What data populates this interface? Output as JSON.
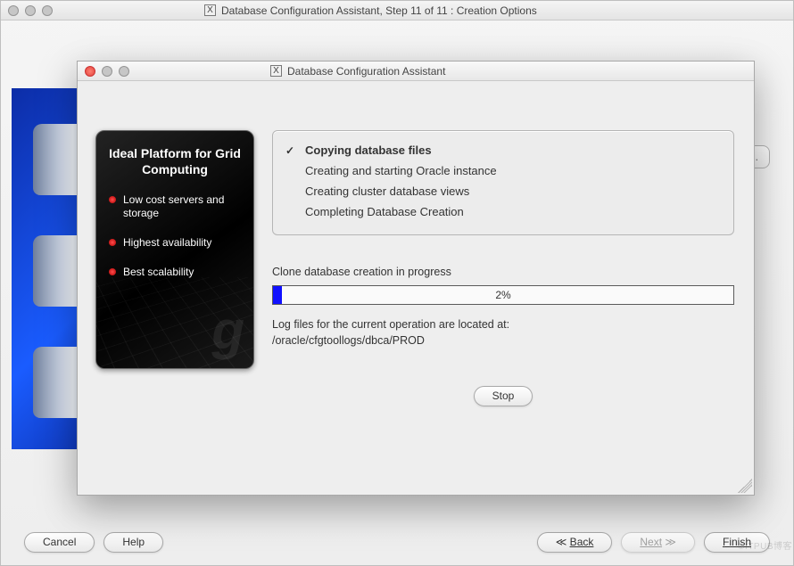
{
  "back_window": {
    "title": "Database Configuration Assistant, Step 11 of 11 : Creation Options",
    "truncated_text": "",
    "hidden_button_fragment": "wse...",
    "buttons": {
      "cancel": "Cancel",
      "help": "Help",
      "back": "Back",
      "next": "Next",
      "finish": "Finish"
    }
  },
  "front_window": {
    "title": "Database Configuration Assistant"
  },
  "banner": {
    "heading": "Ideal Platform for Grid Computing",
    "items": [
      "Low cost servers and storage",
      "Highest availability",
      "Best scalability"
    ]
  },
  "steps": {
    "list": [
      "Copying database files",
      "Creating and starting Oracle instance",
      "Creating cluster database views",
      "Completing Database Creation"
    ],
    "current_index": 0
  },
  "progress": {
    "label": "Clone database creation in progress",
    "percent": 2,
    "percent_text": "2%",
    "log_text_line1": "Log files for the current operation are located at:",
    "log_path": "/oracle/cfgtoollogs/dbca/PROD"
  },
  "buttons": {
    "stop": "Stop"
  },
  "watermark": "©ITPUB博客"
}
